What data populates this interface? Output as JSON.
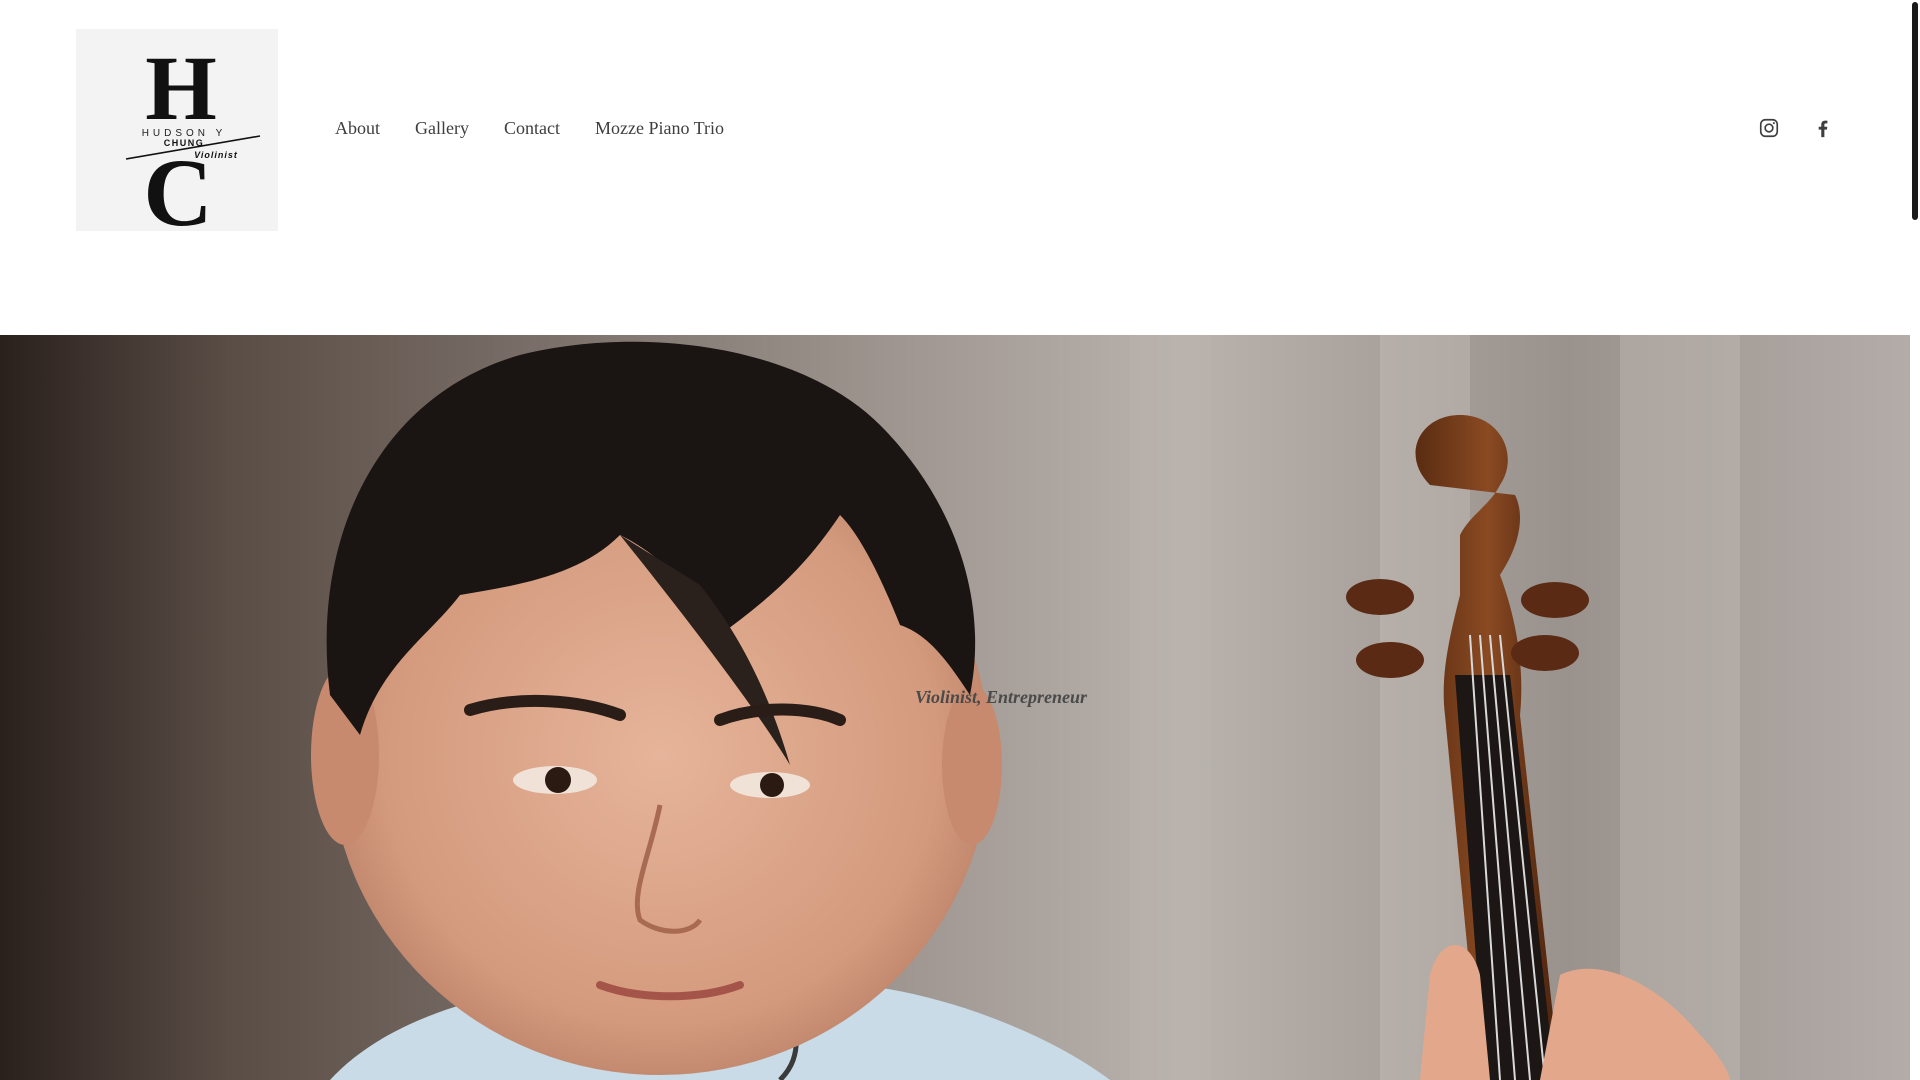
{
  "site": {
    "logo": {
      "monogram_top": "H",
      "name_line": "HUDSON Y",
      "surname": "CHUNG",
      "role": "Violinist",
      "monogram_bottom": "C"
    }
  },
  "nav": {
    "items": [
      {
        "label": "About"
      },
      {
        "label": "Gallery"
      },
      {
        "label": "Contact"
      },
      {
        "label": "Mozze Piano Trio"
      }
    ]
  },
  "social": {
    "icons": [
      "instagram-icon",
      "facebook-icon"
    ]
  },
  "hero": {
    "tagline": "Violinist, Entrepreneur"
  },
  "colors": {
    "nav_text": "#3e3e3e",
    "tagline_text": "#4a4a4a",
    "header_bg": "#ffffff",
    "hero_bg": "#8e8680"
  }
}
